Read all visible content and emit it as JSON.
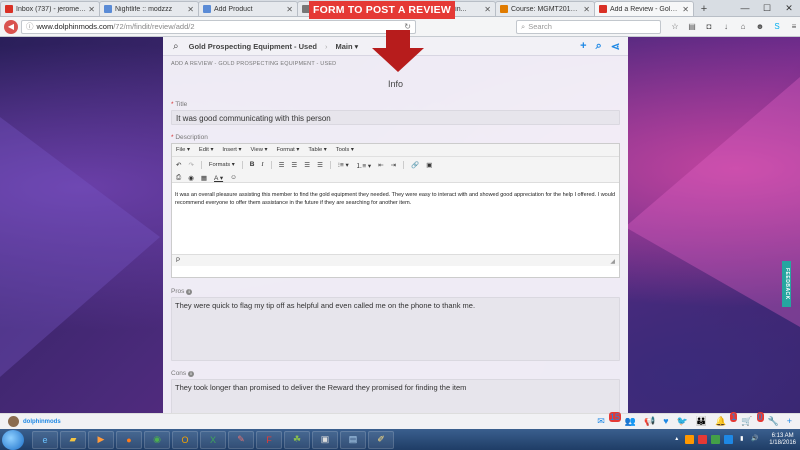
{
  "annotation": {
    "text": "FORM TO POST A REVIEW",
    "color": "#e53935"
  },
  "browser": {
    "tabs": [
      {
        "label": "Inbox (737) - jeromemi...",
        "icon": "gmail-icon",
        "color": "#d93025",
        "active": false
      },
      {
        "label": "Nightlife :: modzzz",
        "icon": "site-icon",
        "color": "#5a8bd6",
        "active": false
      },
      {
        "label": "Add Product",
        "icon": "site-icon",
        "color": "#5a8bd6",
        "active": false
      },
      {
        "label": "",
        "icon": "site-icon",
        "color": "#777777",
        "active": false
      },
      {
        "label": "MGMT2023 Fin...",
        "icon": "site-icon",
        "color": "#777777",
        "active": false
      },
      {
        "label": "Course: MGMT2013 Intr...",
        "icon": "site-icon",
        "color": "#e07b00",
        "active": false
      },
      {
        "label": "Add a Review - Gold Pr...",
        "icon": "site-icon",
        "color": "#d93025",
        "active": true
      }
    ],
    "url_host": "www.dolphinmods.com",
    "url_path": "/72/m/findit/review/add/2",
    "search_placeholder": "Search"
  },
  "site_header": {
    "breadcrumb_1": "Gold Prospecting Equipment - Used",
    "breadcrumb_2": "Main"
  },
  "form": {
    "subcrumb": "ADD A REVIEW - GOLD PROSPECTING EQUIPMENT - USED",
    "section_title": "Info",
    "title_label": "Title",
    "title_value": "It was good communicating with this person",
    "description_label": "Description",
    "editor_menu": [
      "File",
      "Edit",
      "Insert",
      "View",
      "Format",
      "Table",
      "Tools"
    ],
    "formats_label": "Formats",
    "description_value": "It was an overall pleasure assisting this member to find the gold equipment they needed. They were easy to interact with and showed good appreciation for the help I offered. I would recommend everyone to offer them assistance in the future if they are searching for another item.",
    "editor_status": "P",
    "pros_label": "Pros",
    "pros_value": "They were quick to flag my tip off as helpful and even called me on the phone to thank me.",
    "cons_label": "Cons",
    "cons_value": "They took longer than promised to deliver the Reward they promised for finding the item"
  },
  "feedback_tab": "FEEDBACK",
  "site_bar": {
    "username": "dolphinmods",
    "badges": {
      "mail": "15",
      "bell": "1",
      "cart": "0"
    }
  },
  "taskbar": {
    "time": "6:13 AM",
    "date": "1/18/2016"
  }
}
